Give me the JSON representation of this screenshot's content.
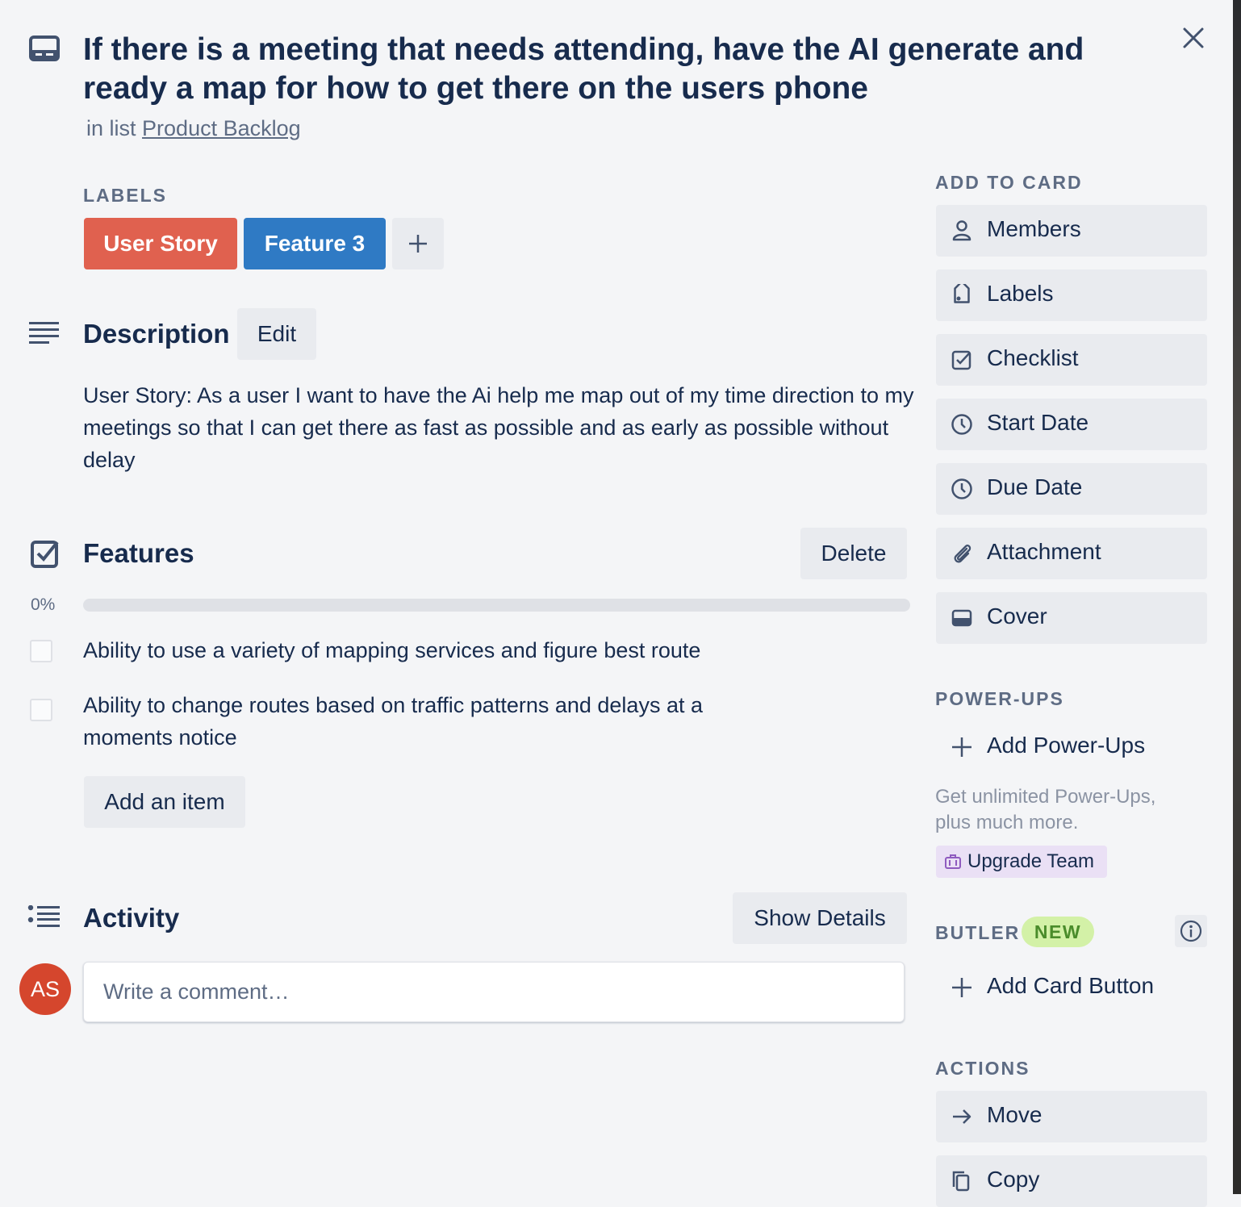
{
  "card": {
    "title": "If there is a meeting that needs attending, have the AI generate and ready a map for how to get there on the users phone",
    "in_list_prefix": "in list",
    "list_name": "Product Backlog"
  },
  "labels": {
    "heading": "LABELS",
    "items": [
      {
        "text": "User Story",
        "color": "#e0614f"
      },
      {
        "text": "Feature 3",
        "color": "#2f7ac4"
      }
    ]
  },
  "description": {
    "heading": "Description",
    "edit_label": "Edit",
    "text": "User Story: As a user I want to have the Ai help me map out of my time direction to my meetings so that I can get there as fast as possible and as early as possible without delay"
  },
  "checklist": {
    "title": "Features",
    "delete_label": "Delete",
    "progress_text": "0%",
    "progress_fraction": 0,
    "items": [
      {
        "text": "Ability to use a variety of mapping services and figure best route",
        "checked": false
      },
      {
        "text": "Ability to change routes based on traffic patterns and delays at a moments notice",
        "checked": false
      }
    ],
    "add_item_label": "Add an item"
  },
  "activity": {
    "title": "Activity",
    "show_details_label": "Show Details",
    "avatar_initials": "AS",
    "comment_placeholder": "Write a comment…"
  },
  "sidebar": {
    "add_to_card_heading": "ADD TO CARD",
    "add_to_card": [
      {
        "label": "Members",
        "icon": "person-icon"
      },
      {
        "label": "Labels",
        "icon": "tag-icon"
      },
      {
        "label": "Checklist",
        "icon": "checkbox-icon"
      },
      {
        "label": "Start Date",
        "icon": "clock-icon"
      },
      {
        "label": "Due Date",
        "icon": "clock-icon"
      },
      {
        "label": "Attachment",
        "icon": "paperclip-icon"
      },
      {
        "label": "Cover",
        "icon": "card-cover-icon"
      }
    ],
    "powerups_heading": "POWER-UPS",
    "add_powerups_label": "Add Power-Ups",
    "upsell_text": "Get unlimited Power-Ups, plus much more.",
    "upgrade_label": "Upgrade Team",
    "butler_heading": "BUTLER",
    "butler_badge": "NEW",
    "add_card_button_label": "Add Card Button",
    "actions_heading": "ACTIONS",
    "actions": [
      {
        "label": "Move",
        "icon": "arrow-right-icon"
      },
      {
        "label": "Copy",
        "icon": "copy-icon"
      }
    ]
  }
}
